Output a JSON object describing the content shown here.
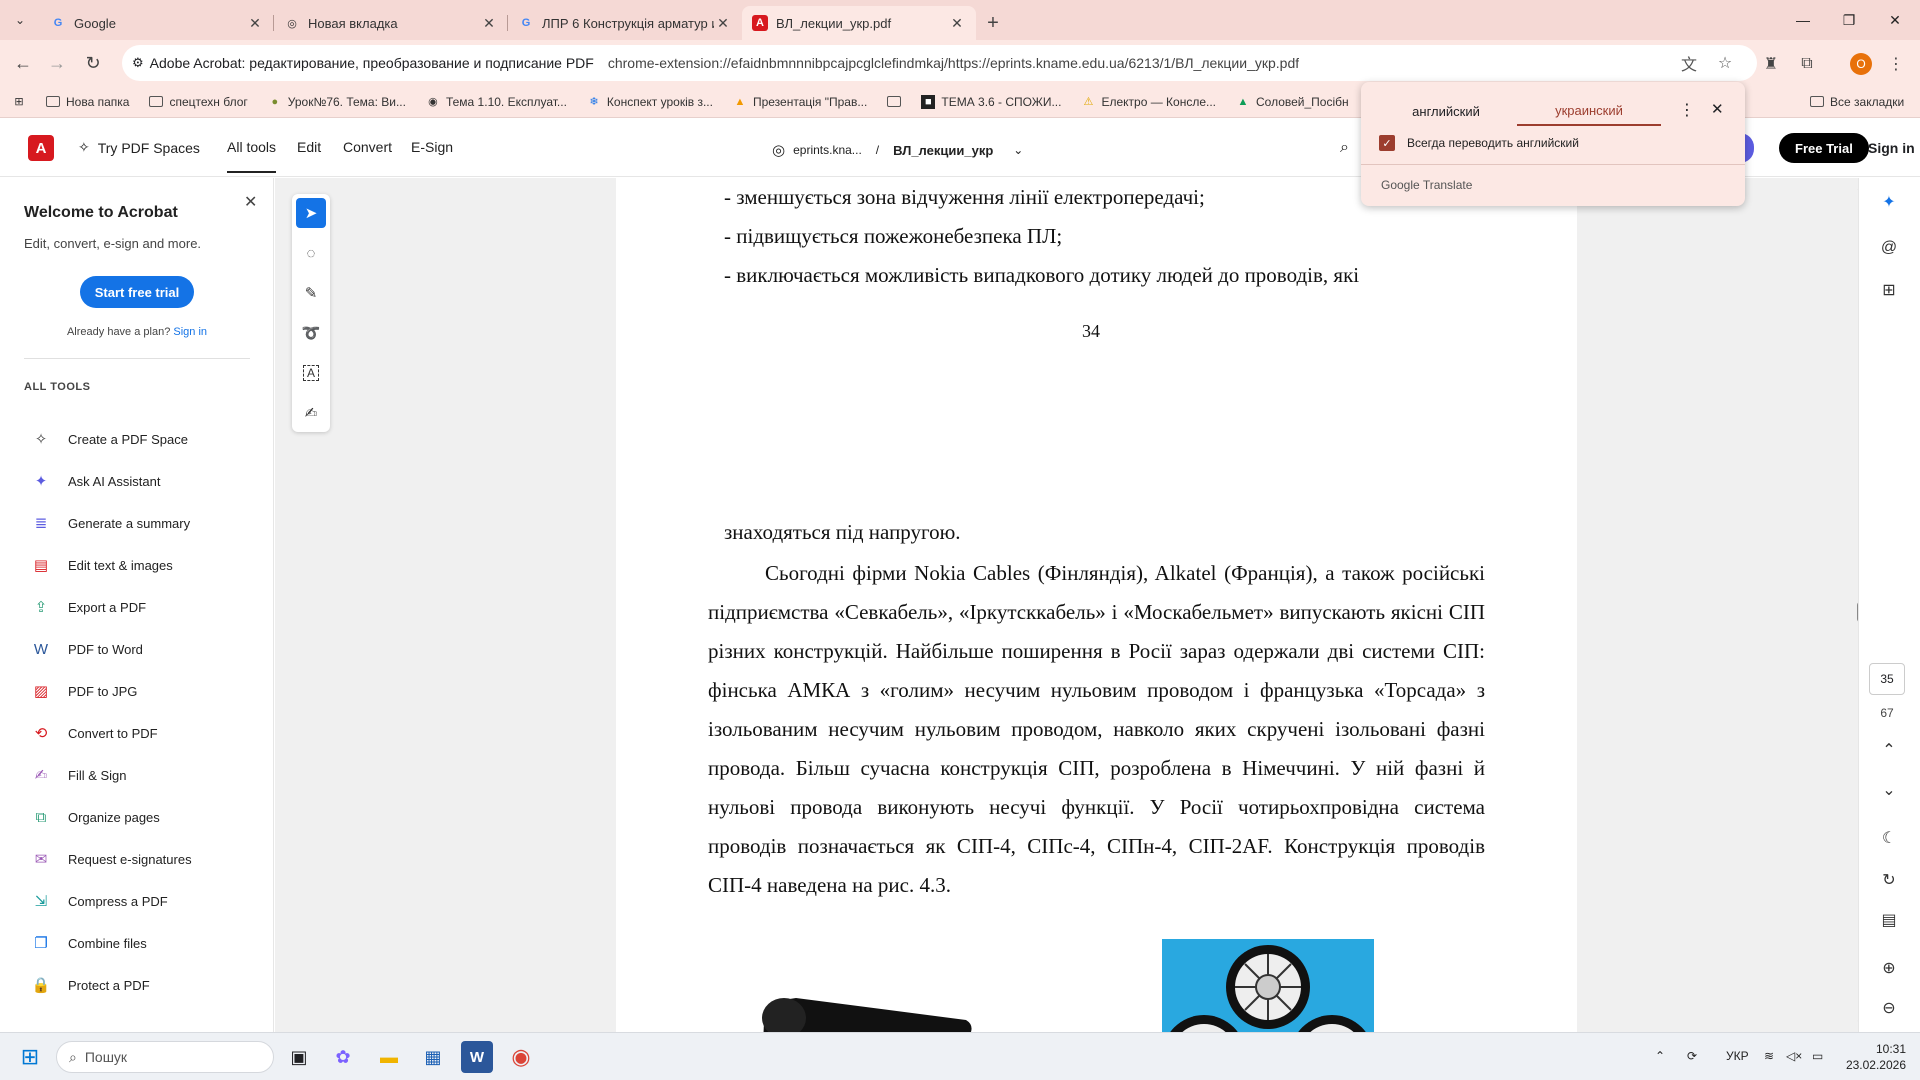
{
  "browser": {
    "tabs": [
      {
        "title": "Google",
        "icon": "google-icon"
      },
      {
        "title": "Новая вкладка",
        "icon": "chrome-icon"
      },
      {
        "title": "ЛПР 6 Конструкція арматур и",
        "icon": "google-icon"
      },
      {
        "title": "ВЛ_лекции_укр.pdf",
        "icon": "acrobat-icon"
      }
    ],
    "omnibox": {
      "site_label": "Adobe Acrobat: редактирование, преобразование и подписание PDF",
      "url": "chrome-extension://efaidnbmnnnibpcajpcglclefindmkaj/https://eprints.kname.edu.ua/6213/1/ВЛ_лекции_укр.pdf"
    },
    "profile_initial": "О",
    "bookmarks": [
      {
        "label": "Нова папка",
        "icon": "folder-icon"
      },
      {
        "label": "спецтехн блог",
        "icon": "folder-icon"
      },
      {
        "label": "Урок№76. Тема: Ви...",
        "icon": "site-icon"
      },
      {
        "label": "Тема 1.10. Експлуат...",
        "icon": "globe-icon"
      },
      {
        "label": "Конспект уроків з...",
        "icon": "snowflake-icon"
      },
      {
        "label": "Презентація \"Прав...",
        "icon": "flame-icon"
      },
      {
        "label": "",
        "icon": "folder-icon"
      },
      {
        "label": "ТЕМА 3.6 - СПОЖИ...",
        "icon": "site-icon"
      },
      {
        "label": "Електро — Консле...",
        "icon": "warning-icon"
      },
      {
        "label": "Соловей_Посібн",
        "icon": "drive-icon"
      }
    ],
    "all_bookmarks": "Все закладки"
  },
  "acrobat": {
    "header": {
      "try_spaces": "Try PDF Spaces",
      "nav": [
        "All tools",
        "Edit",
        "Convert",
        "E-Sign"
      ],
      "breadcrumb_site": "eprints.kna...",
      "breadcrumb_sep": "/",
      "file_name": "ВЛ_лекции_укр",
      "free_trial": "Free Trial",
      "sign_in": "Sign in"
    },
    "left_panel": {
      "title": "Welcome to Acrobat",
      "subtitle": "Edit, convert, e-sign and more.",
      "start_trial": "Start free trial",
      "already": "Already have a plan?",
      "sign_in": "Sign in",
      "section": "ALL TOOLS",
      "tools": [
        {
          "label": "Create a PDF Space",
          "icon": "spaces-icon",
          "color": "#444444"
        },
        {
          "label": "Ask AI Assistant",
          "icon": "ai-assistant-icon",
          "color": "#5c5ce0"
        },
        {
          "label": "Generate a summary",
          "icon": "summary-icon",
          "color": "#5c5ce0"
        },
        {
          "label": "Edit text & images",
          "icon": "edit-text-icon",
          "color": "#d7191f"
        },
        {
          "label": "Export a PDF",
          "icon": "export-pdf-icon",
          "color": "#2d9d78"
        },
        {
          "label": "PDF to Word",
          "icon": "pdf-to-word-icon",
          "color": "#2b579a"
        },
        {
          "label": "PDF to JPG",
          "icon": "pdf-to-jpg-icon",
          "color": "#d7191f"
        },
        {
          "label": "Convert to PDF",
          "icon": "convert-to-pdf-icon",
          "color": "#d7191f"
        },
        {
          "label": "Fill & Sign",
          "icon": "fill-sign-icon",
          "color": "#9b59b6"
        },
        {
          "label": "Organize pages",
          "icon": "organize-pages-icon",
          "color": "#2d9d78"
        },
        {
          "label": "Request e-signatures",
          "icon": "request-esign-icon",
          "color": "#9b59b6"
        },
        {
          "label": "Compress a PDF",
          "icon": "compress-pdf-icon",
          "color": "#1a9c9c"
        },
        {
          "label": "Combine files",
          "icon": "combine-files-icon",
          "color": "#1473e6"
        },
        {
          "label": "Protect a PDF",
          "icon": "protect-pdf-icon",
          "color": "#1473e6"
        }
      ]
    },
    "document": {
      "page34_lines": [
        "- зменшується зона відчуження лінії електропередачі;",
        "- підвищується пожежонебезпека ПЛ;",
        "- виключається можливість випадкового дотику людей до проводів, які"
      ],
      "page34_number": "34",
      "page35_first_line": "знаходяться під напругою.",
      "page35_paragraph": "Сьогодні фірми Nokia Cables (Фінляндія), Alkatel (Франція), а також російські підприємства «Севкабель», «Іркутсккабель» і «Москабельмет» випускають якісні СІП різних конструкцій. Найбільше поширення в Росії зараз одержали дві системи СІП: фінська АМКА з «голим» несучим нульовим проводом і французька «Торсада» з ізольованим несучим нульовим проводом, навколо яких скручені ізольовані фазні провода. Більш сучасна конструкція СІП, розроблена в Німеччині. У ній фазні й нульові провода виконують несучі функції. У Росії чотирьохпровідна система проводів позначається як СІП-4, СІПс-4, СІПн-4, СІП-2АF. Конструкція проводів СІП-4 наведена на рис. 4.3."
    },
    "right_rail": {
      "current_page": "35",
      "total_pages": "67"
    }
  },
  "translate_popup": {
    "lang_source": "английский",
    "lang_target": "украинский",
    "always_translate": "Всегда переводить английский",
    "brand_google": "Google",
    "brand_translate": "Translate"
  },
  "taskbar": {
    "search_placeholder": "Пошук",
    "lang": "УКР",
    "time": "10:31",
    "date": "23.02.2026"
  }
}
